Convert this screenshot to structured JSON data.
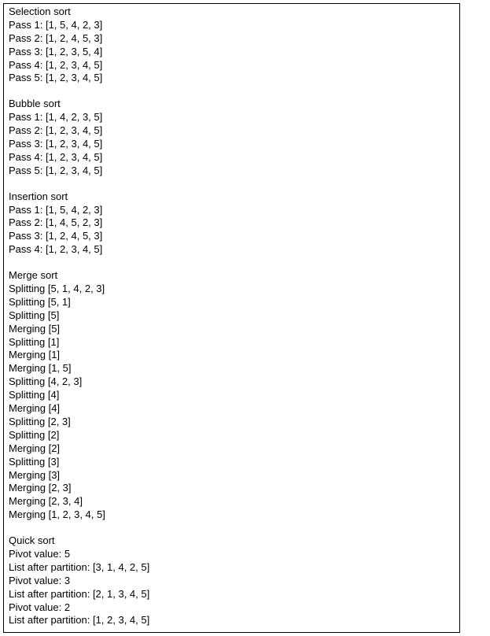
{
  "sections": [
    {
      "title": "Selection sort",
      "lines": [
        "Pass 1: [1, 5, 4, 2, 3]",
        "Pass 2: [1, 2, 4, 5, 3]",
        "Pass 3: [1, 2, 3, 5, 4]",
        "Pass 4: [1, 2, 3, 4, 5]",
        "Pass 5: [1, 2, 3, 4, 5]"
      ]
    },
    {
      "title": "Bubble sort",
      "lines": [
        "Pass 1: [1, 4, 2, 3, 5]",
        "Pass 2: [1, 2, 3, 4, 5]",
        "Pass 3: [1, 2, 3, 4, 5]",
        "Pass 4: [1, 2, 3, 4, 5]",
        "Pass 5: [1, 2, 3, 4, 5]"
      ]
    },
    {
      "title": "Insertion sort",
      "lines": [
        "Pass 1: [1, 5, 4, 2, 3]",
        "Pass 2: [1, 4, 5, 2, 3]",
        "Pass 3: [1, 2, 4, 5, 3]",
        "Pass 4: [1, 2, 3, 4, 5]"
      ]
    },
    {
      "title": "Merge sort",
      "lines": [
        "Splitting [5, 1, 4, 2, 3]",
        "Splitting [5, 1]",
        "Splitting [5]",
        "Merging [5]",
        "Splitting [1]",
        "Merging [1]",
        "Merging [1, 5]",
        "Splitting [4, 2, 3]",
        "Splitting [4]",
        "Merging [4]",
        "Splitting [2, 3]",
        "Splitting [2]",
        "Merging [2]",
        "Splitting [3]",
        "Merging [3]",
        "Merging [2, 3]",
        "Merging [2, 3, 4]",
        "Merging [1, 2, 3, 4, 5]"
      ]
    },
    {
      "title": "Quick sort",
      "lines": [
        "Pivot value: 5",
        "List after partition: [3, 1, 4, 2, 5]",
        "Pivot value: 3",
        "List after partition: [2, 1, 3, 4, 5]",
        "Pivot value: 2",
        "List after partition: [1, 2, 3, 4, 5]"
      ]
    }
  ]
}
